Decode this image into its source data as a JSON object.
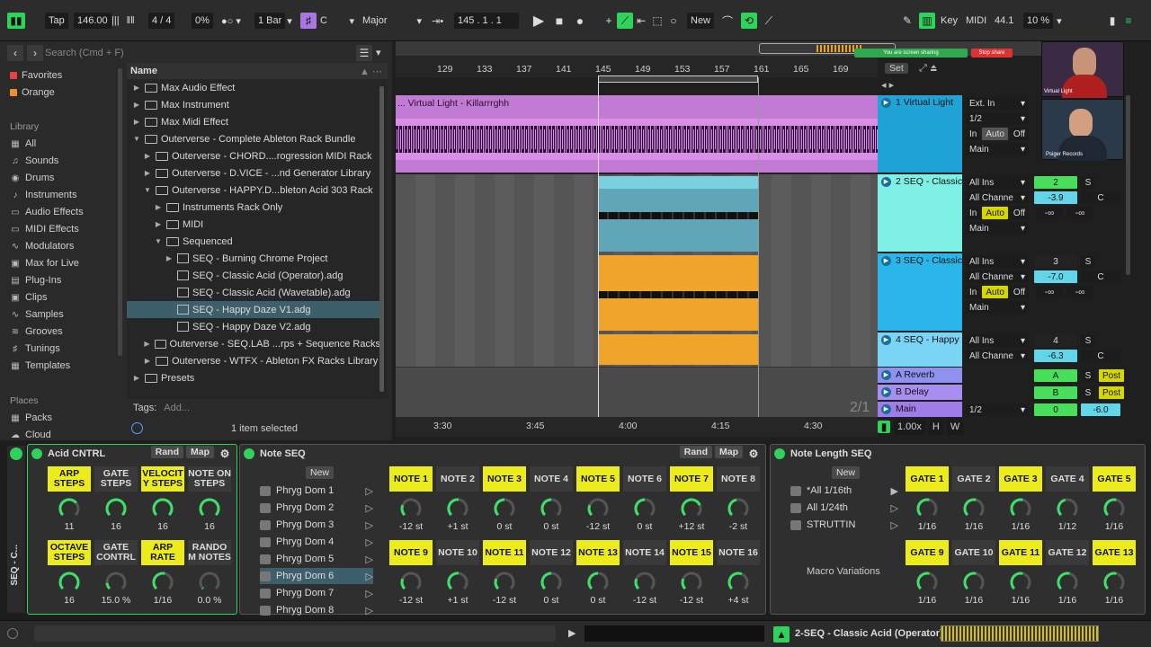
{
  "transport": {
    "tap": "Tap",
    "tempo": "146.00",
    "sig": "4 / 4",
    "groove": "0%",
    "quant": "1 Bar",
    "key": "C",
    "scale": "Major",
    "position": "145 .   1 .   1",
    "new": "New",
    "key_btn": "Key",
    "midi_btn": "MIDI",
    "sample_rate": "44.1",
    "cpu": "10 %"
  },
  "browser": {
    "search_placeholder": "Search (Cmd + F)",
    "name_col": "Name",
    "tags_label": "Tags:",
    "tags_add": "Add...",
    "status": "1 item selected",
    "collections": [
      {
        "label": "Favorites",
        "color": "#e24444"
      },
      {
        "label": "Orange",
        "color": "#f0902a"
      }
    ],
    "library_label": "Library",
    "library": [
      "All",
      "Sounds",
      "Drums",
      "Instruments",
      "Audio Effects",
      "MIDI Effects",
      "Modulators",
      "Max for Live",
      "Plug-Ins",
      "Clips",
      "Samples",
      "Grooves",
      "Tunings",
      "Templates"
    ],
    "places_label": "Places",
    "places": [
      "Packs",
      "Cloud"
    ],
    "tree": [
      {
        "label": "Max Audio Effect",
        "indent": 0,
        "type": "folder"
      },
      {
        "label": "Max Instrument",
        "indent": 0,
        "type": "folder"
      },
      {
        "label": "Max Midi Effect",
        "indent": 0,
        "type": "folder"
      },
      {
        "label": "Outerverse - Complete Ableton Rack Bundle",
        "indent": 0,
        "type": "folder",
        "open": true
      },
      {
        "label": "Outerverse - CHORD....rogression MIDI Rack",
        "indent": 1,
        "type": "folder"
      },
      {
        "label": "Outerverse - D.VICE - ...nd Generator Library",
        "indent": 1,
        "type": "folder"
      },
      {
        "label": "Outerverse - HAPPY.D...bleton Acid 303 Rack",
        "indent": 1,
        "type": "folder",
        "open": true
      },
      {
        "label": "Instruments Rack Only",
        "indent": 2,
        "type": "folder"
      },
      {
        "label": "MIDI",
        "indent": 2,
        "type": "folder"
      },
      {
        "label": "Sequenced",
        "indent": 2,
        "type": "folder",
        "open": true
      },
      {
        "label": "SEQ - Burning Chrome Project",
        "indent": 3,
        "type": "project"
      },
      {
        "label": "SEQ - Classic Acid (Operator).adg",
        "indent": 3,
        "type": "file"
      },
      {
        "label": "SEQ - Classic Acid (Wavetable).adg",
        "indent": 3,
        "type": "file"
      },
      {
        "label": "SEQ - Happy Daze V1.adg",
        "indent": 3,
        "type": "file",
        "selected": true
      },
      {
        "label": "SEQ - Happy Daze V2.adg",
        "indent": 3,
        "type": "file"
      },
      {
        "label": "Outerverse - SEQ.LAB ...rps + Sequence Racks",
        "indent": 1,
        "type": "folder"
      },
      {
        "label": "Outerverse - WTFX - Ableton FX Racks Library",
        "indent": 1,
        "type": "folder"
      },
      {
        "label": "Presets",
        "indent": 0,
        "type": "folder"
      }
    ]
  },
  "arrangement": {
    "ruler": [
      "129",
      "133",
      "137",
      "141",
      "145",
      "149",
      "153",
      "157",
      "161",
      "165",
      "169"
    ],
    "time_ruler": [
      "3:30",
      "3:45",
      "4:00",
      "4:15",
      "4:30"
    ],
    "set_btn": "Set",
    "clip_title": "... Virtual Light - Killarrrghh",
    "page": "2/1",
    "zoom": "1.00x",
    "h": "H",
    "w": "W",
    "tracks": [
      {
        "name": "1 Virtual Light",
        "color": "#20a4d8",
        "input": "Ext. In",
        "ch": "1/2",
        "out": "Main"
      },
      {
        "name": "2 SEQ - Classic",
        "color": "#7ef0e4",
        "input": "All Ins",
        "ch": "All Channe",
        "out": "Main",
        "num": "2",
        "vol": "-3.9",
        "pan": "C",
        "send": "-∞"
      },
      {
        "name": "3 SEQ - Classic",
        "color": "#2ab6e8",
        "input": "All Ins",
        "ch": "All Channe",
        "out": "Main",
        "num": "3",
        "vol": "-7.0",
        "pan": "C",
        "send": "-∞"
      },
      {
        "name": "4 SEQ - Happy",
        "color": "#7ad4f4",
        "input": "All Ins",
        "ch": "All Channe",
        "num": "4",
        "vol": "-6.3",
        "pan": "C"
      },
      {
        "name": "A Reverb",
        "color": "#8f90f0",
        "num": "A",
        "post": "Post"
      },
      {
        "name": "B Delay",
        "color": "#a88ef0",
        "num": "B",
        "post": "Post"
      },
      {
        "name": "Main",
        "color": "#a07ce8",
        "ch": "1/2",
        "num": "0",
        "vol": "-6.0"
      }
    ],
    "io": {
      "in": "In",
      "auto": "Auto",
      "off": "Off",
      "s": "S"
    },
    "webcam": {
      "top_label": "Virtual Light",
      "bottom_label": "Psiger Records",
      "banner": "You are screen sharing",
      "stop": "Stop share"
    }
  },
  "devices": {
    "acid": {
      "title": "Acid CNTRL",
      "rand": "Rand",
      "map": "Map",
      "knobs": [
        {
          "label": "ARP STEPS",
          "value": "11",
          "hl": true
        },
        {
          "label": "GATE STEPS",
          "value": "16",
          "hl": false
        },
        {
          "label": "VELOCIT Y STEPS",
          "value": "16",
          "hl": true
        },
        {
          "label": "NOTE ON STEPS",
          "value": "16",
          "hl": false
        },
        {
          "label": "OCTAVE STEPS",
          "value": "16",
          "hl": true
        },
        {
          "label": "GATE CONTRL",
          "value": "15.0 %",
          "hl": false
        },
        {
          "label": "ARP RATE",
          "value": "1/16",
          "hl": true
        },
        {
          "label": "RANDO M NOTES",
          "value": "0.0 %",
          "hl": false
        }
      ]
    },
    "note": {
      "title": "Note SEQ",
      "rand": "Rand",
      "map": "Map",
      "new": "New",
      "presets": [
        "Phryg Dom 1",
        "Phryg Dom 2",
        "Phryg Dom 3",
        "Phryg Dom 4",
        "Phryg Dom 5",
        "Phryg Dom 6",
        "Phryg Dom 7",
        "Phryg Dom 8"
      ],
      "knobs": [
        {
          "label": "NOTE 1",
          "value": "-12 st",
          "hl": true
        },
        {
          "label": "NOTE 2",
          "value": "+1 st",
          "hl": false
        },
        {
          "label": "NOTE 3",
          "value": "0 st",
          "hl": true
        },
        {
          "label": "NOTE 4",
          "value": "0 st",
          "hl": false
        },
        {
          "label": "NOTE 5",
          "value": "-12 st",
          "hl": true
        },
        {
          "label": "NOTE 6",
          "value": "0 st",
          "hl": false
        },
        {
          "label": "NOTE 7",
          "value": "+12 st",
          "hl": true
        },
        {
          "label": "NOTE 8",
          "value": "-2 st",
          "hl": false
        },
        {
          "label": "NOTE 9",
          "value": "-12 st",
          "hl": true
        },
        {
          "label": "NOTE 10",
          "value": "+1 st",
          "hl": false
        },
        {
          "label": "NOTE 11",
          "value": "-12 st",
          "hl": true
        },
        {
          "label": "NOTE 12",
          "value": "0 st",
          "hl": false
        },
        {
          "label": "NOTE 13",
          "value": "0 st",
          "hl": true
        },
        {
          "label": "NOTE 14",
          "value": "-12 st",
          "hl": false
        },
        {
          "label": "NOTE 15",
          "value": "-12 st",
          "hl": true
        },
        {
          "label": "NOTE 16",
          "value": "+4 st",
          "hl": false
        }
      ]
    },
    "gate": {
      "title": "Note Length SEQ",
      "new": "New",
      "macro": "Macro Variations",
      "presets": [
        "*All 1/16th",
        "All 1/24th",
        "STRUTTIN"
      ],
      "knobs": [
        {
          "label": "GATE 1",
          "value": "1/16",
          "hl": true
        },
        {
          "label": "GATE 2",
          "value": "1/16",
          "hl": false
        },
        {
          "label": "GATE 3",
          "value": "1/16",
          "hl": true
        },
        {
          "label": "GATE 4",
          "value": "1/12",
          "hl": false
        },
        {
          "label": "GATE 5",
          "value": "1/16",
          "hl": true
        },
        {
          "label": "GATE 9",
          "value": "1/16",
          "hl": true
        },
        {
          "label": "GATE 10",
          "value": "1/16",
          "hl": false
        },
        {
          "label": "GATE 11",
          "value": "1/16",
          "hl": true
        },
        {
          "label": "GATE 12",
          "value": "1/16",
          "hl": false
        },
        {
          "label": "GATE 13",
          "value": "1/16",
          "hl": true
        }
      ]
    },
    "side_title": "SEQ - C..."
  },
  "status": {
    "track": "2-SEQ - Classic Acid (Operator)"
  }
}
